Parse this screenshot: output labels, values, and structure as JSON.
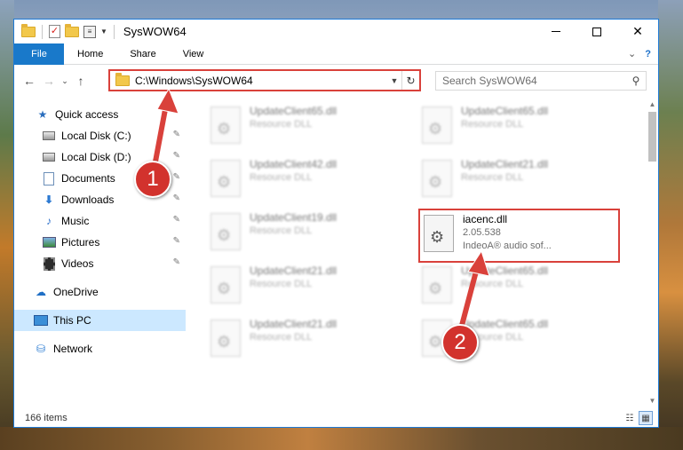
{
  "window": {
    "title": "SysWOW64",
    "controls": {
      "minimize_icon": "minimize-icon",
      "maximize_icon": "maximize-icon",
      "close_glyph": "✕"
    }
  },
  "quick_access_toolbar": {
    "icons": [
      "folder-icon",
      "properties-check-icon",
      "folder-icon",
      "properties-icon",
      "customize-dropdown-icon"
    ]
  },
  "ribbon": {
    "tabs": [
      "File",
      "Home",
      "Share",
      "View"
    ],
    "expand_glyph": "⌄",
    "help_glyph": "?"
  },
  "address": {
    "path": "C:\\Windows\\SysWOW64",
    "refresh_glyph": "↻"
  },
  "search": {
    "placeholder": "Search SysWOW64"
  },
  "nav": {
    "back_glyph": "←",
    "forward_glyph": "→",
    "recent_glyph": "⌄",
    "up_glyph": "↑"
  },
  "sidebar": {
    "items": [
      {
        "label": "Quick access",
        "icon": "star-icon"
      },
      {
        "label": "Local Disk (C:)",
        "icon": "drive-icon",
        "pinned": true
      },
      {
        "label": "Local Disk (D:)",
        "icon": "drive-icon",
        "pinned": true
      },
      {
        "label": "Documents",
        "icon": "documents-icon",
        "pinned": true
      },
      {
        "label": "Downloads",
        "icon": "download-icon",
        "pinned": true
      },
      {
        "label": "Music",
        "icon": "music-icon",
        "pinned": true
      },
      {
        "label": "Pictures",
        "icon": "pictures-icon",
        "pinned": true
      },
      {
        "label": "Videos",
        "icon": "videos-icon",
        "pinned": true
      },
      {
        "label": "OneDrive",
        "icon": "cloud-icon"
      },
      {
        "label": "This PC",
        "icon": "computer-icon",
        "selected": true
      },
      {
        "label": "Network",
        "icon": "network-icon"
      }
    ],
    "pin_glyph": "📌"
  },
  "files": {
    "items": [
      {
        "name": "UpdateClient65.dll",
        "sub": "Resource DLL"
      },
      {
        "name": "UpdateClient65.dll",
        "sub": "Resource DLL"
      },
      {
        "name": "UpdateClient42.dll",
        "sub": "Resource DLL"
      },
      {
        "name": "UpdateClient21.dll",
        "sub": "Resource DLL"
      },
      {
        "name": "UpdateClient19.dll",
        "sub": "Resource DLL"
      },
      {
        "name": "iacenc.dll",
        "version": "2.05.538",
        "description": "IndeoA® audio sof..."
      },
      {
        "name": "UpdateClient21.dll",
        "sub": "Resource DLL"
      },
      {
        "name": "UpdateClient65.dll",
        "sub": "Resource DLL"
      },
      {
        "name": "UpdateClient21.dll",
        "sub": "Resource DLL"
      },
      {
        "name": "UpdateClient65.dll",
        "sub": "Resource DLL"
      }
    ]
  },
  "status": {
    "item_count": "166 items",
    "view_icons": [
      "details-view-icon",
      "large-icons-view-icon"
    ]
  },
  "annotations": {
    "badge1": "1",
    "badge2": "2",
    "accent_color": "#d9413b"
  }
}
